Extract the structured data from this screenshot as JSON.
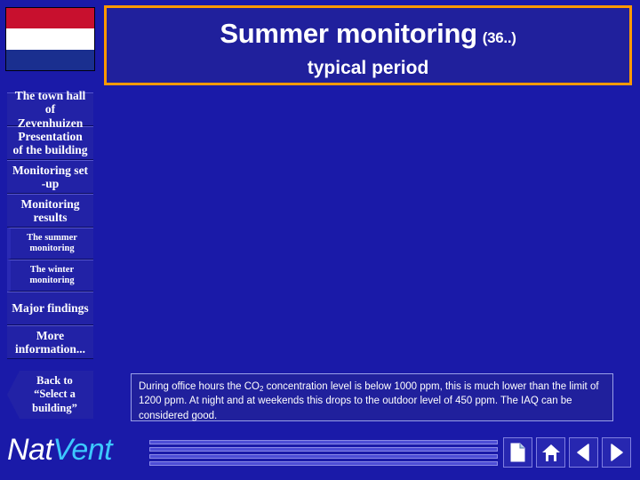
{
  "slide": {
    "title": "Summer monitoring",
    "title_suffix": "(36..)",
    "subtitle": "typical period"
  },
  "flag": {
    "name": "netherlands-flag",
    "colors": [
      "#c8102e",
      "#ffffff",
      "#1a2f8f"
    ]
  },
  "sidebar": {
    "items": [
      {
        "name": "town-hall",
        "line1": "The town hall of",
        "line2": "Zevenhuizen",
        "level": 1
      },
      {
        "name": "presentation",
        "line1": "Presentation",
        "line2": "of the building",
        "level": 1
      },
      {
        "name": "monitoring-setup",
        "line1": "Monitoring set",
        "line2": "-up",
        "level": 1
      },
      {
        "name": "monitoring-results",
        "line1": "Monitoring",
        "line2": "results",
        "level": 1
      },
      {
        "name": "summer-monitoring",
        "line1": "The summer",
        "line2": "monitoring",
        "level": 2
      },
      {
        "name": "winter-monitoring",
        "line1": "The winter",
        "line2": "monitoring",
        "level": 2
      },
      {
        "name": "major-findings",
        "line1": "Major findings",
        "line2": "",
        "level": 1
      },
      {
        "name": "more-information",
        "line1": "More",
        "line2": "information...",
        "level": 1
      }
    ],
    "back_button": {
      "line1": "Back  to",
      "line2": "“Select  a",
      "line3": "building”"
    }
  },
  "body": {
    "text_part1": "During office hours the CO",
    "text_sub": "2",
    "text_part2": " concentration level is below 1000 ppm, this is much lower than the limit of 1200 ppm. At night and at weekends this drops to the outdoor level of 450 ppm. The IAQ can be considered good."
  },
  "footer": {
    "logo_part1": "Nat",
    "logo_part2": "Vent",
    "icons": [
      "document-icon",
      "home-icon",
      "previous-arrow-icon",
      "next-arrow-icon"
    ]
  },
  "colors": {
    "background": "#1a1aa8",
    "title_border": "#ff9900",
    "panel": "#20209c",
    "accent_text": "#3cc8ff"
  }
}
